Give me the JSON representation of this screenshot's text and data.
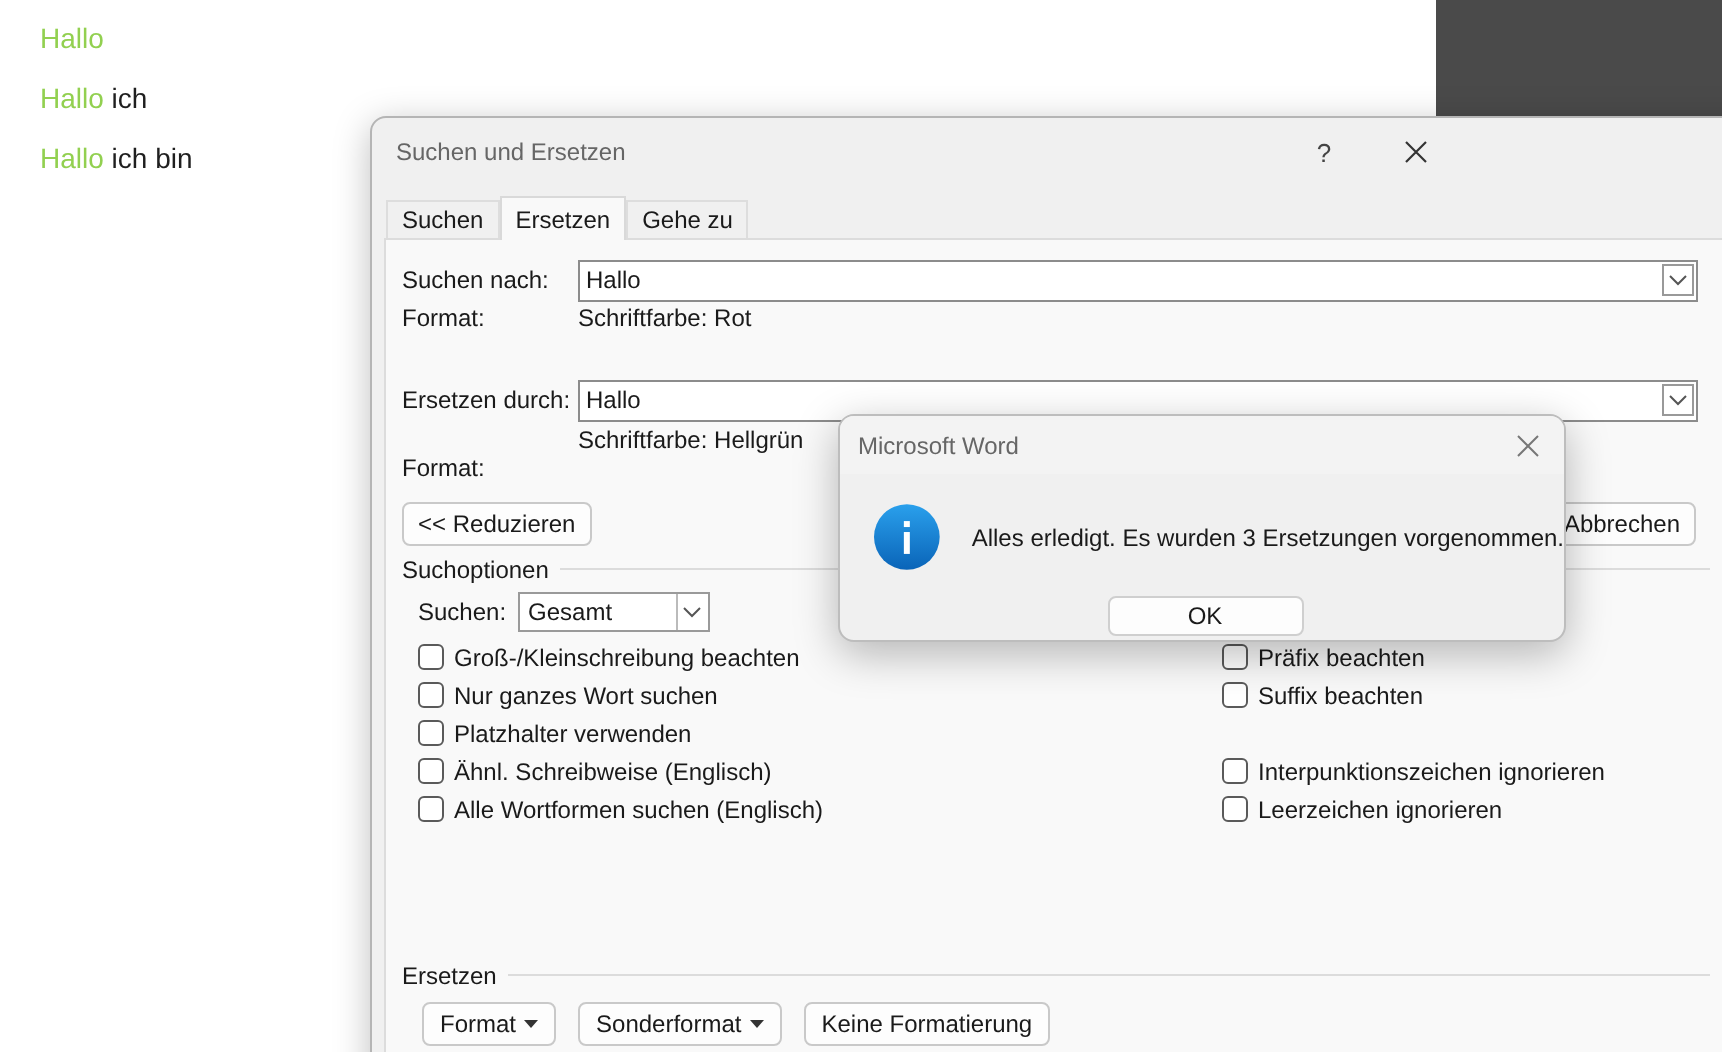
{
  "document": {
    "lines": [
      {
        "segments": [
          {
            "text": "Hallo",
            "color": "#92d050"
          }
        ]
      },
      {
        "segments": [
          {
            "text": "Hallo",
            "color": "#92d050"
          },
          {
            "text": "ich",
            "color": "#1f1f1f"
          }
        ]
      },
      {
        "segments": [
          {
            "text": "Hallo",
            "color": "#92d050"
          },
          {
            "text": "ich bin",
            "color": "#1f1f1f"
          }
        ]
      }
    ]
  },
  "dialog": {
    "title": "Suchen und Ersetzen",
    "help": "?",
    "tabs": [
      {
        "label": "Suchen",
        "selected": false
      },
      {
        "label": "Ersetzen",
        "selected": true
      },
      {
        "label": "Gehe zu",
        "selected": false
      }
    ],
    "find": {
      "label": "Suchen nach:",
      "value": "Hallo",
      "format_label": "Format:",
      "format": "Schriftfarbe: Rot"
    },
    "replace": {
      "label": "Ersetzen durch:",
      "value": "Hallo",
      "format_label": "Format:",
      "format": "Schriftfarbe: Hellgrün"
    },
    "less_button": "<< Reduzieren",
    "cancel_button": "Abbrechen",
    "search_options": {
      "title": "Suchoptionen",
      "search_label": "Suchen:",
      "search_value": "Gesamt",
      "left": [
        {
          "label": "Groß-/Kleinschreibung beachten",
          "checked": false
        },
        {
          "label": "Nur ganzes Wort suchen",
          "checked": false
        },
        {
          "label": "Platzhalter verwenden",
          "checked": false
        },
        {
          "label": "Ähnl. Schreibweise (Englisch)",
          "checked": false
        },
        {
          "label": "Alle Wortformen suchen (Englisch)",
          "checked": false
        }
      ],
      "right": [
        {
          "label": "Präfix beachten",
          "checked": false
        },
        {
          "label": "Suffix beachten",
          "checked": false
        },
        {
          "label": "Interpunktionszeichen ignorieren",
          "checked": false
        },
        {
          "label": "Leerzeichen ignorieren",
          "checked": false
        }
      ]
    },
    "replace_section": {
      "title": "Ersetzen",
      "buttons": [
        {
          "label": "Format",
          "menu": true
        },
        {
          "label": "Sonderformat",
          "menu": true
        },
        {
          "label": "Keine Formatierung",
          "menu": false
        }
      ]
    }
  },
  "message_box": {
    "title": "Microsoft Word",
    "message": "Alles erledigt. Es wurden 3 Ersetzungen vorgenommen.",
    "button": "OK"
  }
}
